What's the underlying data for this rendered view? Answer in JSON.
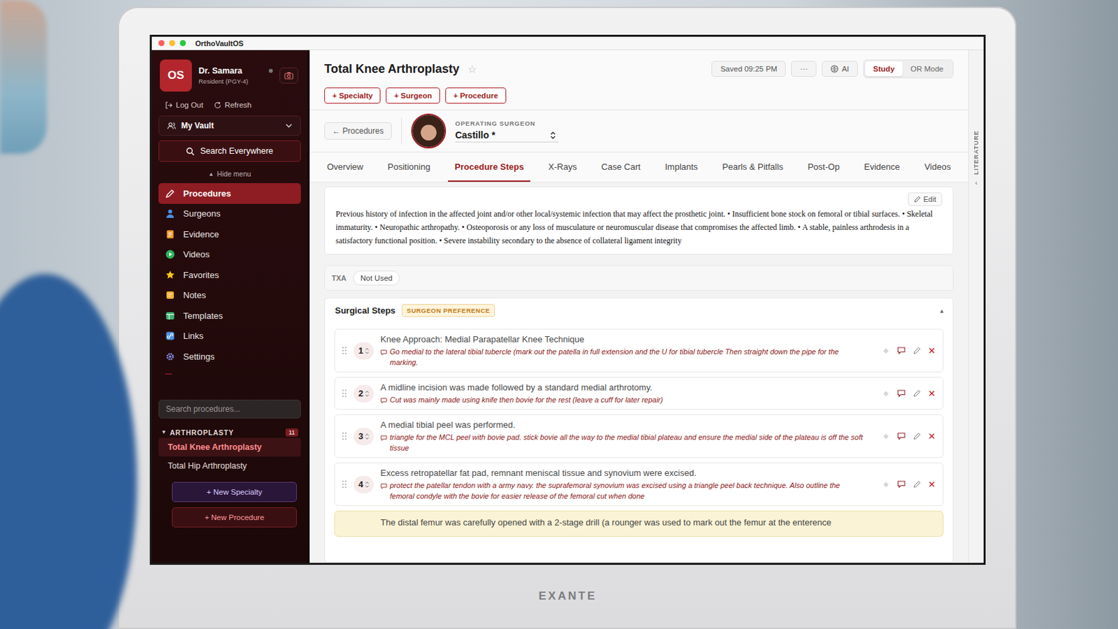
{
  "photo": {
    "monitor_brand": "EXANTE"
  },
  "window": {
    "title": "OrthoVaultOS",
    "controls": [
      {
        "color": "#ff5f57"
      },
      {
        "color": "#febc2e"
      },
      {
        "color": "#28c840"
      }
    ]
  },
  "user": {
    "initials": "OS",
    "name": "Dr. Samara",
    "role": "Resident (PGY-4)",
    "online": false
  },
  "account_links": [
    {
      "label": "Log Out"
    },
    {
      "label": "Refresh"
    }
  ],
  "vault": {
    "label": "My Vault"
  },
  "search_everywhere": {
    "label": "Search Everywhere"
  },
  "hide_menu": {
    "arrow": "▲",
    "label": "Hide menu"
  },
  "nav": [
    {
      "label": "Procedures",
      "selected": true,
      "color": "#ffffff"
    },
    {
      "label": "Surgeons",
      "selected": false,
      "color": "#4a90e2"
    },
    {
      "label": "Evidence",
      "selected": false,
      "color": "#f0a030"
    },
    {
      "label": "Videos",
      "selected": false,
      "color": "#2fb35a"
    },
    {
      "label": "Favorites",
      "selected": false,
      "color": "#f5c518"
    },
    {
      "label": "Notes",
      "selected": false,
      "color": "#f2b233"
    },
    {
      "label": "Templates",
      "selected": false,
      "color": "#3cb371"
    },
    {
      "label": "Links",
      "selected": false,
      "color": "#4a8fe0"
    },
    {
      "label": "Settings",
      "selected": false,
      "color": "#8a8ff0"
    }
  ],
  "procedure_search": {
    "placeholder": "Search procedures..."
  },
  "specialties": [
    {
      "name": "ARTHROPLASTY",
      "count": "11",
      "expanded": true,
      "arrow": "▼",
      "procedures": [
        {
          "name": "Total Knee Arthroplasty",
          "selected": true
        },
        {
          "name": "Total Hip Arthroplasty",
          "selected": false
        }
      ]
    }
  ],
  "sidebar_buttons": [
    {
      "label": "+ New Specialty",
      "kind": "specialty"
    },
    {
      "label": "+ New Procedure",
      "kind": "procedure"
    }
  ],
  "header": {
    "title": "Total Knee Arthroplasty",
    "favorite": false,
    "star": "☆",
    "saved": "Saved 09:25 PM",
    "more": "···",
    "ai": "AI",
    "modes": [
      {
        "label": "Study",
        "selected": true
      },
      {
        "label": "OR Mode",
        "selected": false
      }
    ]
  },
  "add_buttons": [
    "+ Specialty",
    "+ Surgeon",
    "+ Procedure"
  ],
  "back_button": "← Procedures",
  "surgeon": {
    "caption": "OPERATING SURGEON",
    "name": "Castillo *"
  },
  "tabs": [
    {
      "label": "Overview",
      "selected": false
    },
    {
      "label": "Positioning",
      "selected": false
    },
    {
      "label": "Procedure Steps",
      "selected": true
    },
    {
      "label": "X-Rays",
      "selected": false
    },
    {
      "label": "Case Cart",
      "selected": false
    },
    {
      "label": "Implants",
      "selected": false
    },
    {
      "label": "Pearls & Pitfalls",
      "selected": false
    },
    {
      "label": "Post-Op",
      "selected": false
    },
    {
      "label": "Evidence",
      "selected": false
    },
    {
      "label": "Videos",
      "selected": false
    }
  ],
  "contraindications": {
    "edit": "Edit",
    "text": "Previous history of infection in the affected joint and/or other local/systemic infection that may affect the prosthetic joint. • Insufficient bone stock on femoral or tibial surfaces. • Skeletal immaturity. • Neuropathic arthropathy. • Osteoporosis or any loss of musculature or neuromuscular disease that compromises the affected limb. • A stable, painless arthrodesis in a satisfactory functional position. • Severe instability secondary to the absence of collateral ligament integrity"
  },
  "txa": {
    "label": "TXA",
    "value": "Not Used"
  },
  "steps_section": {
    "title": "Surgical Steps",
    "badge": "SURGEON PREFERENCE",
    "expanded": true,
    "toggle": "▴"
  },
  "steps": [
    {
      "kind": "step",
      "number": "1",
      "title": "Knee Approach: Medial Parapatellar Knee Technique",
      "note": "Go medial to the lateral tibial tubercle (mark out the patella in full extension and the U for tibial tubercle Then straight down the pipe for the marking."
    },
    {
      "kind": "step",
      "number": "2",
      "title": "A midline incision was made followed by a standard medial arthrotomy.",
      "note": "Cut was mainly made using knife then bovie for the rest (leave a cuff for later repair)"
    },
    {
      "kind": "step",
      "number": "3",
      "title": "A medial tibial peel was performed.",
      "note": "triangle for the MCL peel with bovie pad. stick bovie all the way to the medial tibial plateau and ensure the medial side of the plateau is off the soft tissue"
    },
    {
      "kind": "step",
      "number": "4",
      "title": "Excess retropatellar fat pad, remnant meniscal tissue and synovium were excised.",
      "note": "protect the patellar tendon with a army navy. the suprafemoral synovium was excised using a triangle peel back technique. Also outline the femoral condyle with the bovie for easier release of the femoral cut when done"
    },
    {
      "kind": "highlight",
      "number": "",
      "title": "The distal femur was carefully opened with a 2-stage drill (a rounger was used to mark out the femur at the enterence",
      "note": ""
    }
  ],
  "literature_tab": {
    "label": "LITERATURE",
    "arrow": "‹"
  }
}
